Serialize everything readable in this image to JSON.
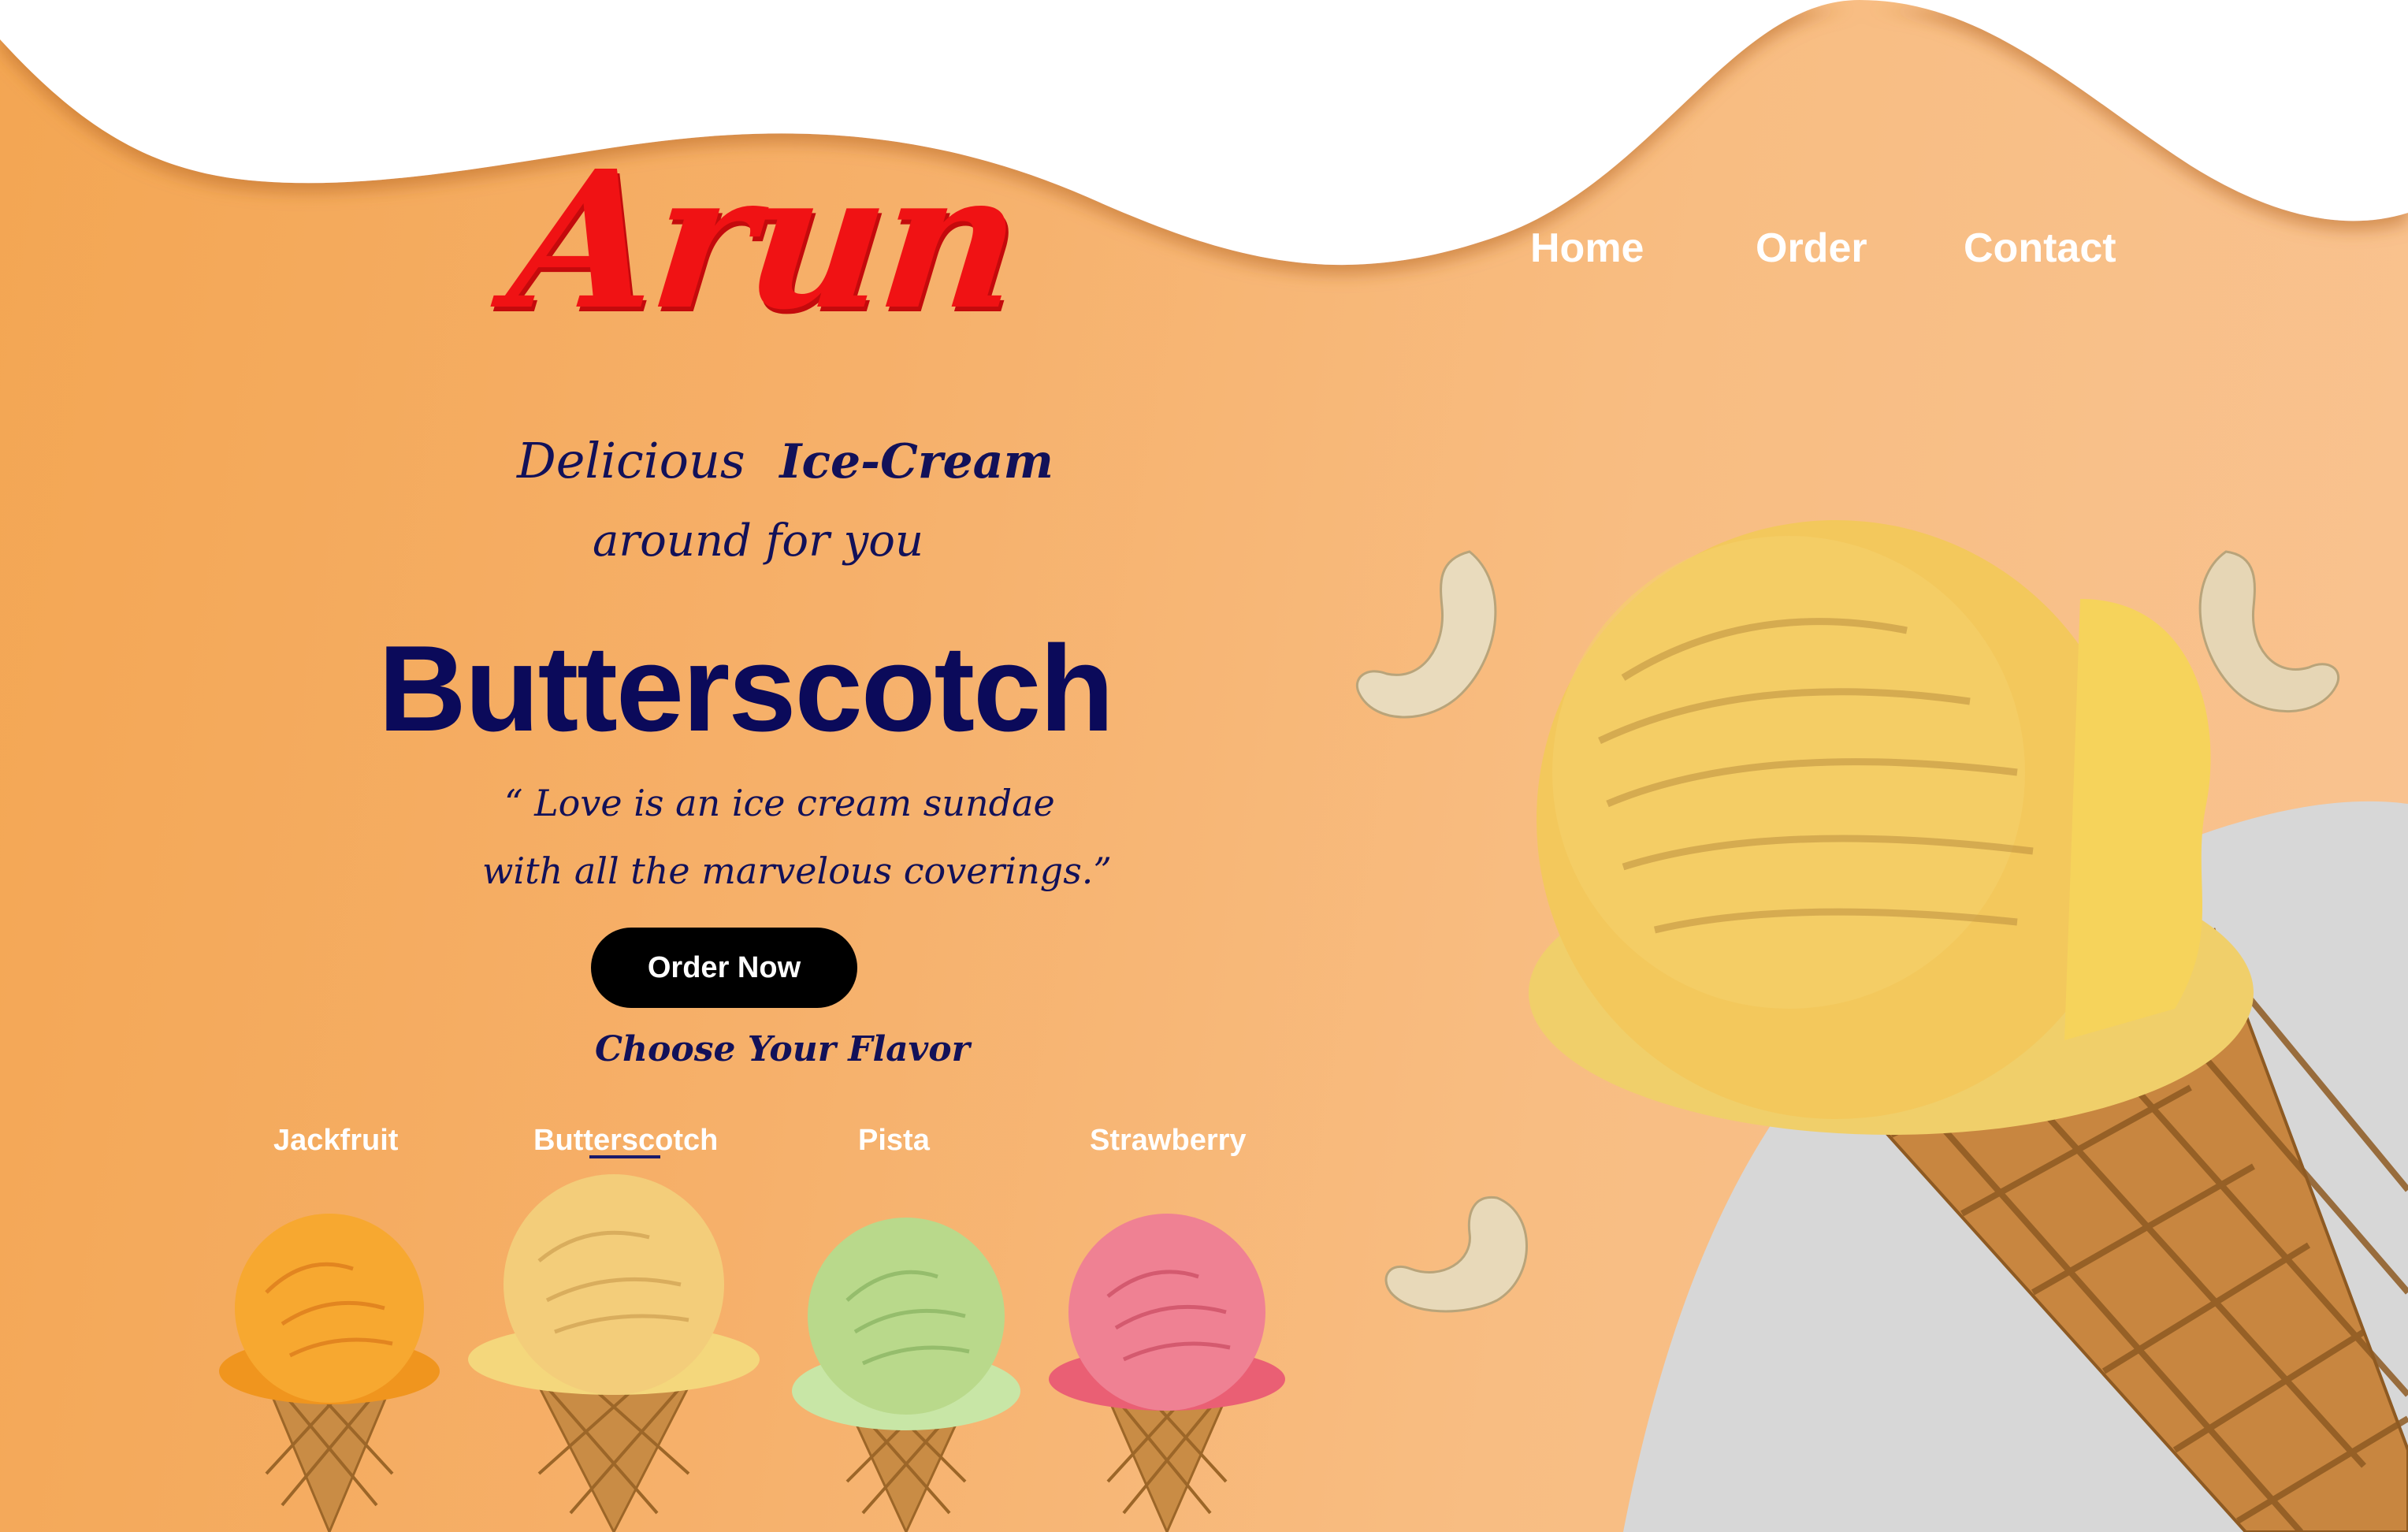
{
  "brand": {
    "logo_text": "Arun"
  },
  "nav": {
    "home": "Home",
    "order": "Order",
    "contact": "Contact"
  },
  "hero": {
    "tagline_line1_a": "Delicious",
    "tagline_line1_b": "Ice-Cream",
    "tagline_line2": "around for you",
    "flavor_title": "Butterscotch",
    "quote_line1": "“ Love is an ice cream sundae",
    "quote_line2": "with all the marvelous coverings.”",
    "cta_label": "Order Now",
    "choose_label": "Choose Your Flavor"
  },
  "flavors": {
    "items": [
      {
        "label": "Jackfruit",
        "color": "#f6a531"
      },
      {
        "label": "Butterscotch",
        "color": "#f2c86c",
        "selected": true
      },
      {
        "label": "Pista",
        "color": "#b9d98b"
      },
      {
        "label": "Strawberry",
        "color": "#ee7a8b"
      }
    ]
  },
  "colors": {
    "background_orange": "#f4a85a",
    "logo_red": "#f01214",
    "navy_text": "#0b0a5a",
    "button_black": "#000000",
    "grey_shape": "#d7d7d7"
  }
}
